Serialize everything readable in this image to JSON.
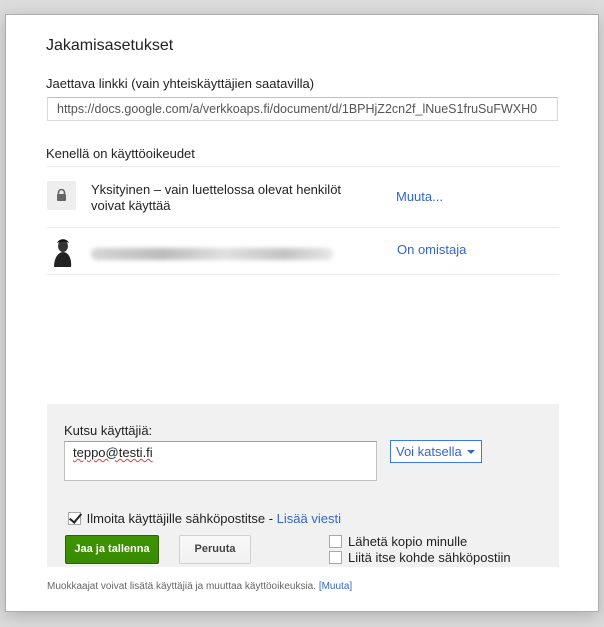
{
  "dialog": {
    "title": "Jakamisasetukset",
    "link_label": "Jaettava linkki (vain yhteiskäyttäjien saatavilla)",
    "link_value": "https://docs.google.com/a/verkkoaps.fi/document/d/1BPHjZ2cn2f_lNueS1fruSuFWXH0",
    "access_label": "Kenellä on käyttöoikeudet",
    "privacy": {
      "icon": "lock-icon",
      "text": "Yksityinen – vain luettelossa olevat henkilöt voivat käyttää",
      "change_link": "Muuta..."
    },
    "owner": {
      "icon": "person-icon",
      "role": "On omistaja"
    },
    "invite": {
      "label": "Kutsu käyttäjiä:",
      "input_value": "teppo@testi.fi",
      "permission": "Voi katsella",
      "notify_checked": true,
      "notify_text": "Ilmoita käyttäjille sähköpostitse",
      "notify_separator": " - ",
      "add_message": "Lisää viesti",
      "share_button": "Jaa ja tallenna",
      "cancel_button": "Peruuta",
      "send_copy": "Lähetä kopio minulle",
      "paste_item": "Liitä itse kohde sähköpostiin"
    },
    "footer": {
      "note": "Muokkaajat voivat lisätä käyttäjiä ja muuttaa käyttöoikeuksia.",
      "change_link": "[Muuta]"
    }
  },
  "colors": {
    "link": "#3366cc",
    "primary_button": "#3d9400",
    "panel": "#f1f1f1"
  }
}
